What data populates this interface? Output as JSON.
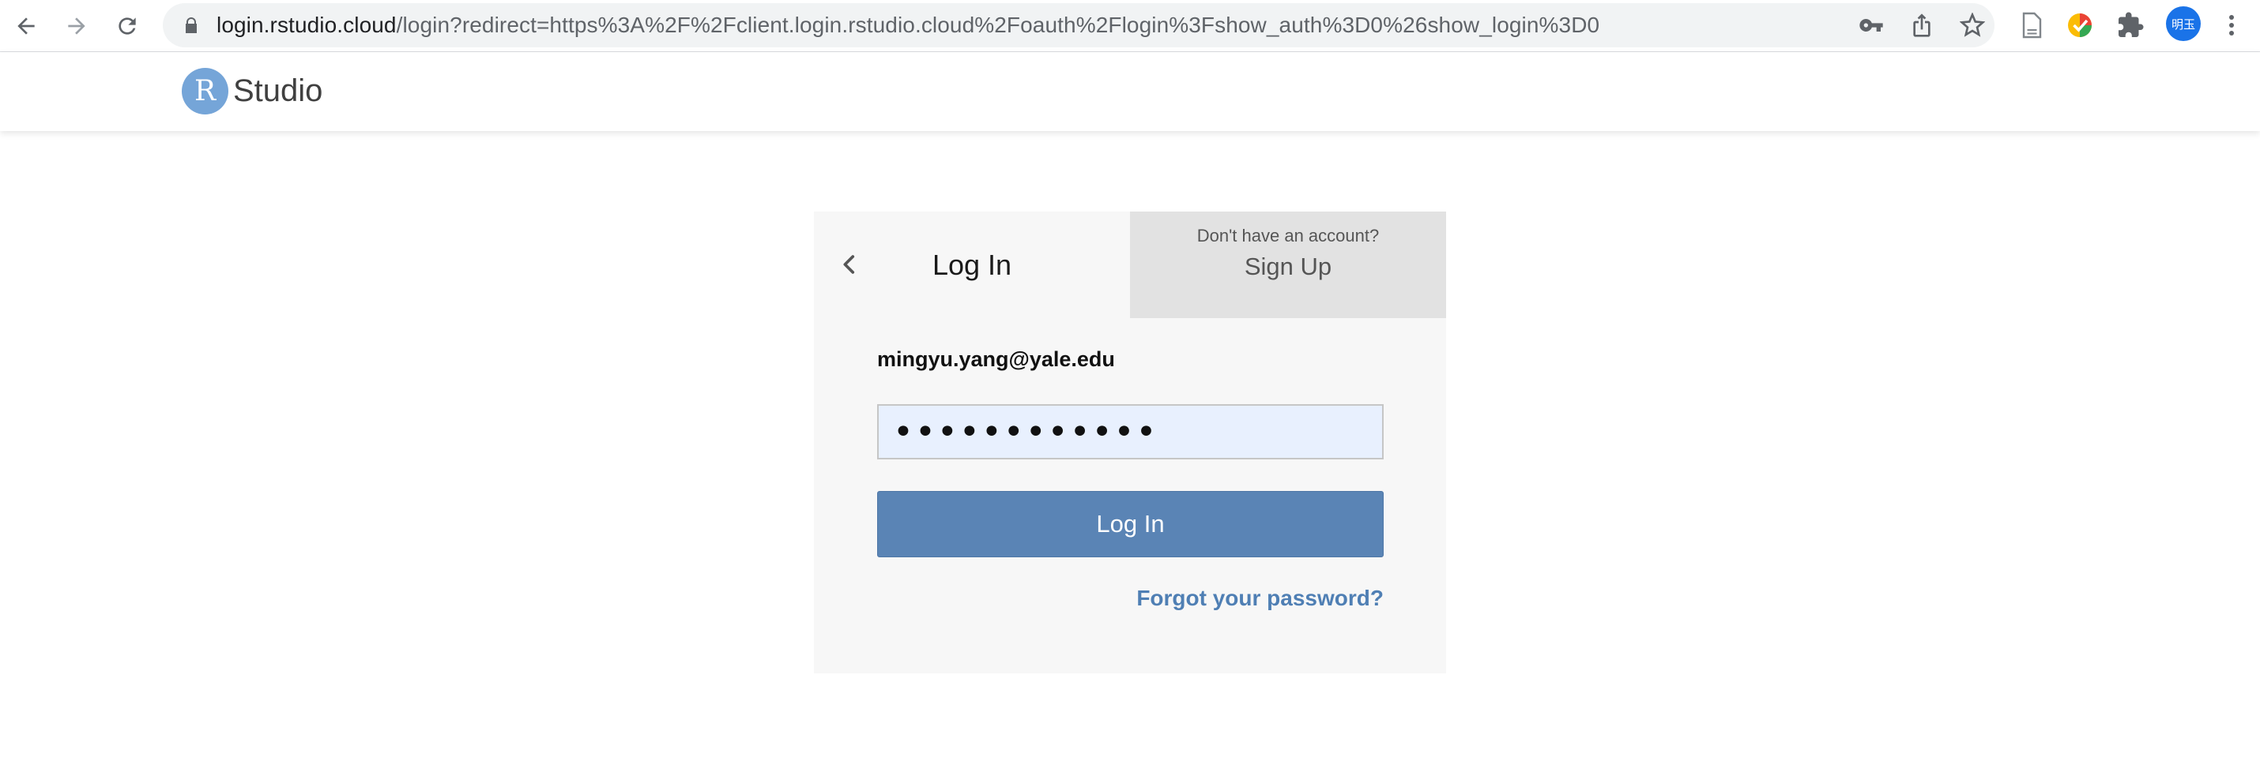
{
  "browser": {
    "url_host": "login.rstudio.cloud",
    "url_path": "/login?redirect=https%3A%2F%2Fclient.login.rstudio.cloud%2Foauth%2Flogin%3Fshow_auth%3D0%26show_login%3D0",
    "profile_initials": "明玉",
    "icons": [
      "back-icon",
      "forward-icon",
      "reload-icon",
      "lock-icon",
      "key-icon",
      "share-icon",
      "star-icon",
      "page-icon",
      "extension-color-icon",
      "puzzle-icon",
      "menu-dots-icon"
    ]
  },
  "header": {
    "logo_letter": "R",
    "logo_text": "Studio"
  },
  "login_card": {
    "login_tab_label": "Log In",
    "signup_hint": "Don't have an account?",
    "signup_tab_label": "Sign Up",
    "email": "mingyu.yang@yale.edu",
    "password_value": "••••••••••••",
    "login_button_label": "Log In",
    "forgot_password_label": "Forgot your password?"
  },
  "colors": {
    "brand_blue": "#75a5d8",
    "button_blue": "#5a84b5",
    "link_blue": "#4f7fb4",
    "autofill_bg": "#e8f0fe"
  }
}
